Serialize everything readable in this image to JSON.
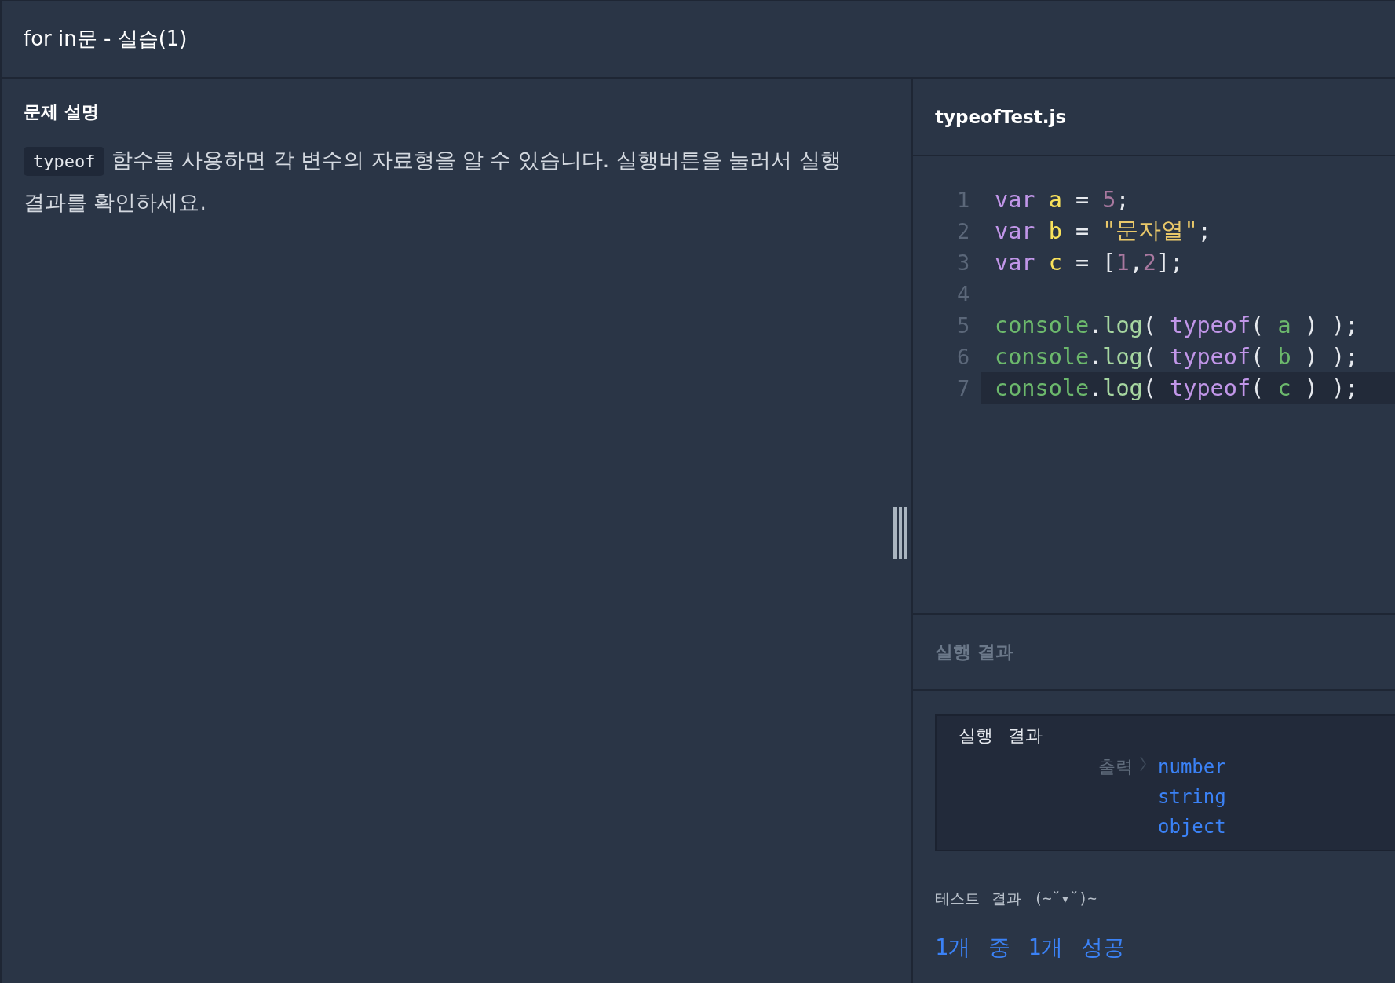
{
  "header": {
    "title": "for in문 - 실습(1)"
  },
  "problem": {
    "heading": "문제 설명",
    "code_term": "typeof",
    "text": "함수를 사용하면 각 변수의 자료형을 알 수 있습니다. 실행버튼을 눌러서 실행 결과를 확인하세요."
  },
  "editor": {
    "filename": "typeofTest.js",
    "lines": [
      {
        "number": "1",
        "active": false,
        "tokens": [
          {
            "text": "var",
            "kind": "keyword"
          },
          {
            "text": " a",
            "kind": "variable"
          },
          {
            "text": " = ",
            "kind": "plain"
          },
          {
            "text": "5",
            "kind": "number"
          },
          {
            "text": ";",
            "kind": "plain"
          }
        ]
      },
      {
        "number": "2",
        "active": false,
        "tokens": [
          {
            "text": "var",
            "kind": "keyword"
          },
          {
            "text": " b",
            "kind": "variable"
          },
          {
            "text": " = ",
            "kind": "plain"
          },
          {
            "text": "\"문자열\"",
            "kind": "string"
          },
          {
            "text": ";",
            "kind": "plain"
          }
        ]
      },
      {
        "number": "3",
        "active": false,
        "tokens": [
          {
            "text": "var",
            "kind": "keyword"
          },
          {
            "text": " c",
            "kind": "variable"
          },
          {
            "text": " = [",
            "kind": "plain"
          },
          {
            "text": "1",
            "kind": "number"
          },
          {
            "text": ",",
            "kind": "plain"
          },
          {
            "text": "2",
            "kind": "number"
          },
          {
            "text": "];",
            "kind": "plain"
          }
        ]
      },
      {
        "number": "4",
        "active": false
      },
      {
        "number": "5",
        "active": false,
        "tokens": [
          {
            "text": "console",
            "kind": "object"
          },
          {
            "text": ".",
            "kind": "plain"
          },
          {
            "text": "log",
            "kind": "method"
          },
          {
            "text": "( ",
            "kind": "plain"
          },
          {
            "text": "typeof",
            "kind": "keyword"
          },
          {
            "text": "( ",
            "kind": "plain"
          },
          {
            "text": "a",
            "kind": "argument"
          },
          {
            "text": " ) );",
            "kind": "plain"
          }
        ]
      },
      {
        "number": "6",
        "active": false,
        "tokens": [
          {
            "text": "console",
            "kind": "object"
          },
          {
            "text": ".",
            "kind": "plain"
          },
          {
            "text": "log",
            "kind": "method"
          },
          {
            "text": "( ",
            "kind": "plain"
          },
          {
            "text": "typeof",
            "kind": "keyword"
          },
          {
            "text": "( ",
            "kind": "plain"
          },
          {
            "text": "b",
            "kind": "argument"
          },
          {
            "text": " ) );",
            "kind": "plain"
          }
        ]
      },
      {
        "number": "7",
        "active": true,
        "tokens": [
          {
            "text": "console",
            "kind": "object"
          },
          {
            "text": ".",
            "kind": "plain"
          },
          {
            "text": "log",
            "kind": "method"
          },
          {
            "text": "( ",
            "kind": "plain"
          },
          {
            "text": "typeof",
            "kind": "keyword"
          },
          {
            "text": "( ",
            "kind": "plain"
          },
          {
            "text": "c",
            "kind": "argument"
          },
          {
            "text": " ) );",
            "kind": "plain"
          }
        ]
      }
    ]
  },
  "result": {
    "heading": "실행 결과",
    "box_title": "실행 결과",
    "output_label": "출력",
    "output_lines": [
      "number",
      "string",
      "object"
    ],
    "test_label": "테스트 결과 (~˘▾˘)~",
    "test_summary": "1개 중 1개 성공"
  }
}
